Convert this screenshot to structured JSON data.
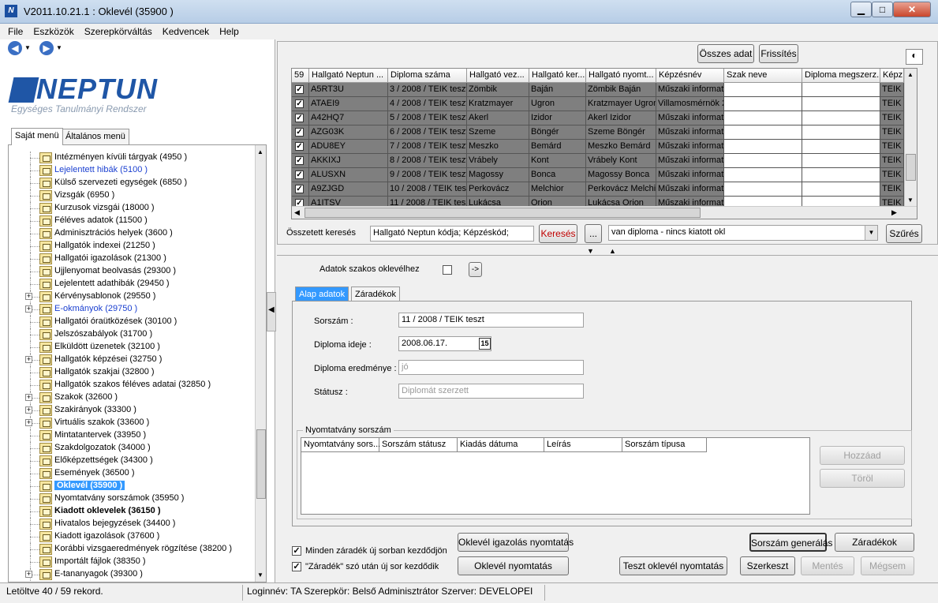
{
  "window": {
    "title": "V2011.10.21.1 : Oklevél (35900 )",
    "app_icon": "N"
  },
  "menu": [
    "File",
    "Eszközök",
    "Szerepkörváltás",
    "Kedvencek",
    "Help"
  ],
  "logo": {
    "word": "NEPTUN",
    "subtitle": "Egységes Tanulmányi Rendszer"
  },
  "left_tabs": {
    "own": "Saját menü",
    "general": "Általános menü"
  },
  "tree": [
    {
      "label": "Intézményen kívüli tárgyak (4950  )",
      "exp": false,
      "style": "normal"
    },
    {
      "label": "Lejelentett hibák (5100  )",
      "exp": false,
      "style": "link"
    },
    {
      "label": "Külső szervezeti egységek (6850  )",
      "exp": false,
      "style": "normal"
    },
    {
      "label": "Vizsgák (6950  )",
      "exp": false,
      "style": "normal"
    },
    {
      "label": "Kurzusok vizsgái (18000  )",
      "exp": false,
      "style": "normal"
    },
    {
      "label": "Féléves adatok (11500  )",
      "exp": false,
      "style": "normal"
    },
    {
      "label": "Adminisztrációs helyek (3600  )",
      "exp": false,
      "style": "normal"
    },
    {
      "label": "Hallgatók indexei (21250  )",
      "exp": false,
      "style": "normal"
    },
    {
      "label": "Hallgatói igazolások (21300  )",
      "exp": false,
      "style": "normal"
    },
    {
      "label": "Ujjlenyomat beolvasás (29300  )",
      "exp": false,
      "style": "normal"
    },
    {
      "label": "Lejelentett adathibák (29450  )",
      "exp": false,
      "style": "normal"
    },
    {
      "label": "Kérvénysablonok (29550  )",
      "exp": true,
      "style": "normal"
    },
    {
      "label": "E-okmányok (29750  )",
      "exp": true,
      "style": "link"
    },
    {
      "label": "Hallgatói óraütközések (30100  )",
      "exp": false,
      "style": "normal"
    },
    {
      "label": "Jelszószabályok (31700  )",
      "exp": false,
      "style": "normal"
    },
    {
      "label": "Elküldött üzenetek (32100  )",
      "exp": false,
      "style": "normal"
    },
    {
      "label": "Hallgatók képzései (32750  )",
      "exp": true,
      "style": "normal"
    },
    {
      "label": "Hallgatók szakjai (32800  )",
      "exp": false,
      "style": "normal"
    },
    {
      "label": "Hallgatók szakos féléves adatai (32850  )",
      "exp": false,
      "style": "normal"
    },
    {
      "label": "Szakok (32600  )",
      "exp": true,
      "style": "normal"
    },
    {
      "label": "Szakirányok (33300  )",
      "exp": true,
      "style": "normal"
    },
    {
      "label": "Virtuális szakok (33600  )",
      "exp": true,
      "style": "normal"
    },
    {
      "label": "Mintatantervek (33950  )",
      "exp": false,
      "style": "normal"
    },
    {
      "label": "Szakdolgozatok (34000  )",
      "exp": false,
      "style": "normal"
    },
    {
      "label": "Előképzettségek (34300  )",
      "exp": false,
      "style": "normal"
    },
    {
      "label": "Események (36500  )",
      "exp": false,
      "style": "normal"
    },
    {
      "label": "Oklevél (35900  )",
      "exp": false,
      "style": "selected"
    },
    {
      "label": "Nyomtatvány sorszámok (35950  )",
      "exp": false,
      "style": "normal"
    },
    {
      "label": "Kiadott oklevelek (36150  )",
      "exp": false,
      "style": "bold"
    },
    {
      "label": "Hivatalos bejegyzések (34400  )",
      "exp": false,
      "style": "normal"
    },
    {
      "label": "Kiadott igazolások (37600  )",
      "exp": false,
      "style": "normal"
    },
    {
      "label": "Korábbi vizsgaeredmények rögzítése (38200  )",
      "exp": false,
      "style": "normal"
    },
    {
      "label": "Importált fájlok (38350  )",
      "exp": false,
      "style": "normal"
    },
    {
      "label": "E-tananyagok (39300  )",
      "exp": true,
      "style": "normal"
    }
  ],
  "toolbar": {
    "all_data": "Összes adat",
    "refresh": "Frissítés"
  },
  "grid": {
    "headers": [
      "59",
      "Hallgató Neptun ...",
      "Diploma száma",
      "Hallgató vez...",
      "Hallgató ker...",
      "Hallgató nyomt...",
      "Képzésnév",
      "Szak neve",
      "Diploma megszerz...",
      "Képz"
    ],
    "rows": [
      [
        "A5RT3U",
        "3 / 2008 / TEIK teszt",
        "Zömbik",
        "Baján",
        "Zömbik Baján",
        "Műszaki informatika",
        "",
        "",
        "TEIK"
      ],
      [
        "ATAEI9",
        "4 / 2008 / TEIK teszt",
        "Kratzmayer",
        "Ugron",
        "Kratzmayer Ugron",
        "Villamosmérnök 2",
        "",
        "",
        "TEIK"
      ],
      [
        "A42HQ7",
        "5 / 2008 / TEIK teszt",
        "Akerl",
        "Izidor",
        "Akerl Izidor",
        "Műszaki informatika",
        "",
        "",
        "TEIK"
      ],
      [
        "AZG03K",
        "6 / 2008 / TEIK teszt",
        "Szeme",
        "Böngér",
        "Szeme Böngér",
        "Műszaki informatika",
        "",
        "",
        "TEIK"
      ],
      [
        "ADU8EY",
        "7 / 2008 / TEIK teszt",
        "Meszko",
        "Bemárd",
        "Meszko Bemárd",
        "Műszaki informatika",
        "",
        "",
        "TEIK"
      ],
      [
        "AKKIXJ",
        "8 / 2008 / TEIK teszt",
        "Vrábely",
        "Kont",
        "Vrábely Kont",
        "Műszaki informatika",
        "",
        "",
        "TEIK"
      ],
      [
        "ALUSXN",
        "9 / 2008 / TEIK teszt",
        "Magossy",
        "Bonca",
        "Magossy Bonca",
        "Műszaki informatika",
        "",
        "",
        "TEIK"
      ],
      [
        "A9ZJGD",
        "10 / 2008 / TEIK teszt",
        "Perkovácz",
        "Melchior",
        "Perkovácz Melchior",
        "Műszaki informatika",
        "",
        "",
        "TEIK"
      ],
      [
        "A1ITSV",
        "11 / 2008 / TEIK teszt",
        "Lukácsa",
        "Orion",
        "Lukácsa Orion",
        "Műszaki informatika",
        "",
        "",
        "TEIK"
      ]
    ]
  },
  "search": {
    "label": "Összetett keresés",
    "fields": "Hallgató Neptun kódja; Képzéskód;",
    "search_btn": "Keresés",
    "dots_btn": "...",
    "filter": "van diploma  -  nincs kiatott okl",
    "filter_btn": "Szűrés"
  },
  "major_diploma": {
    "label": "Adatok szakos oklevélhez",
    "arrow_btn": "->"
  },
  "detail_tabs": {
    "basic": "Alap adatok",
    "clauses": "Záradékok"
  },
  "form": {
    "serial_label": "Sorszám :",
    "serial_value": "11 / 2008 / TEIK teszt",
    "date_label": "Diploma ideje :",
    "date_value": "2008.06.17.",
    "date_btn": "15",
    "result_label": "Diploma eredménye :",
    "result_value": "jó",
    "status_label": "Státusz :",
    "status_value": "Diplomát szerzett"
  },
  "form_group": {
    "title": "Nyomtatvány sorszám",
    "headers": [
      "Nyomtatvány sors...",
      "Sorszám státusz",
      "Kiadás dátuma",
      "Leírás",
      "Sorszám típusa"
    ],
    "add_btn": "Hozzáad",
    "delete_btn": "Töröl"
  },
  "options": {
    "clause_newline": "Minden záradék új sorban kezdődjön",
    "word_newline": "\"Záradék\" szó után új sor kezdődik"
  },
  "actions": {
    "cert_print": "Oklevél igazolás nyomtatás",
    "diploma_print": "Oklevél nyomtatás",
    "test_print": "Teszt oklevél nyomtatás",
    "generate": "Sorszám generálás",
    "clauses": "Záradékok",
    "edit": "Szerkeszt",
    "save": "Mentés",
    "cancel": "Mégsem"
  },
  "status": {
    "loaded": "Letöltve 40 / 59 rekord.",
    "login": "Loginnév: TA  Szerepkör: Belső Adminisztrátor  Szerver: DEVELOPEI"
  }
}
